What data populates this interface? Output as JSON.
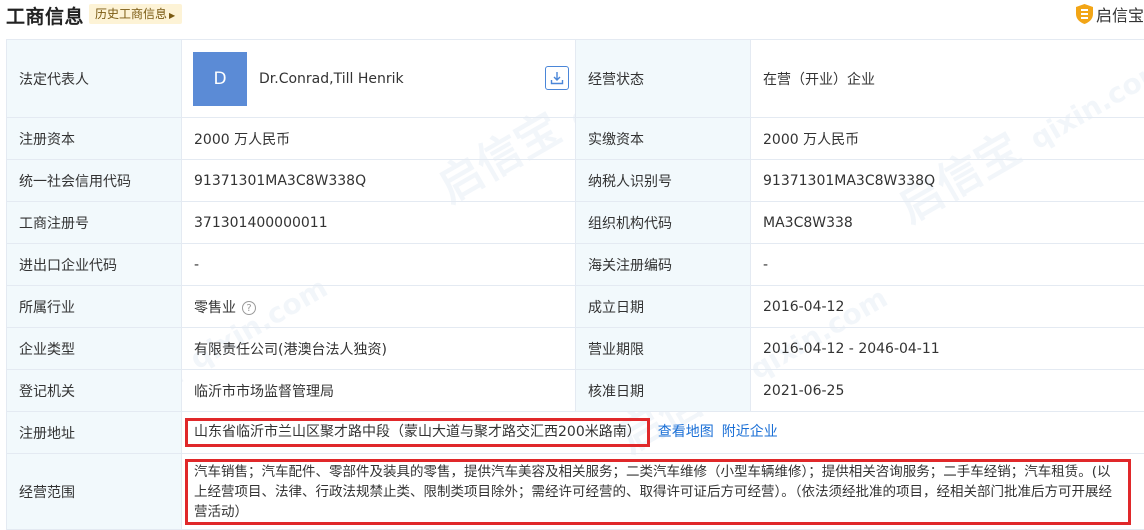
{
  "header": {
    "title": "工商信息",
    "history_button": "历史工商信息",
    "brand_name": "启信宝"
  },
  "watermark": {
    "cn": "启信宝",
    "en": "qixin.com"
  },
  "rows": {
    "legal_rep": {
      "label": "法定代表人",
      "avatar_letter": "D",
      "name": "Dr.Conrad,Till Henrik",
      "right_label": "经营状态",
      "right_value": "在营（开业）企业"
    },
    "reg_capital": {
      "label": "注册资本",
      "value": "2000 万人民币",
      "right_label": "实缴资本",
      "right_value": "2000 万人民币"
    },
    "credit_code": {
      "label": "统一社会信用代码",
      "value": "91371301MA3C8W338Q",
      "right_label": "纳税人识别号",
      "right_value": "91371301MA3C8W338Q"
    },
    "reg_no": {
      "label": "工商注册号",
      "value": "371301400000011",
      "right_label": "组织机构代码",
      "right_value": "MA3C8W338"
    },
    "import_export": {
      "label": "进出口企业代码",
      "value": "-",
      "right_label": "海关注册编码",
      "right_value": "-"
    },
    "industry": {
      "label": "所属行业",
      "value": "零售业",
      "right_label": "成立日期",
      "right_value": "2016-04-12"
    },
    "company_type": {
      "label": "企业类型",
      "value": "有限责任公司(港澳台法人独资)",
      "right_label": "营业期限",
      "right_value": "2016-04-12 - 2046-04-11"
    },
    "authority": {
      "label": "登记机关",
      "value": "临沂市市场监督管理局",
      "right_label": "核准日期",
      "right_value": "2021-06-25"
    },
    "address": {
      "label": "注册地址",
      "value": "山东省临沂市兰山区聚才路中段（蒙山大道与聚才路交汇西200米路南）",
      "map_link": "查看地图",
      "nearby_link": "附近企业"
    },
    "scope": {
      "label": "经营范围",
      "value": "汽车销售；汽车配件、零部件及装具的零售，提供汽车美容及相关服务；二类汽车维修（小型车辆维修）；提供相关咨询服务；二手车经销；汽车租赁。(以上经营项目、法律、行政法规禁止类、限制类项目除外；需经许可经营的、取得许可证后方可经营）。（依法须经批准的项目，经相关部门批准后方可开展经营活动）"
    }
  },
  "colors": {
    "label_bg": "#f2f9fc",
    "border": "#e4eaf2",
    "link": "#1a6fd6",
    "highlight": "#e0282a",
    "avatar_bg": "#5b8bd6",
    "tag_bg": "#fdf3d6"
  }
}
